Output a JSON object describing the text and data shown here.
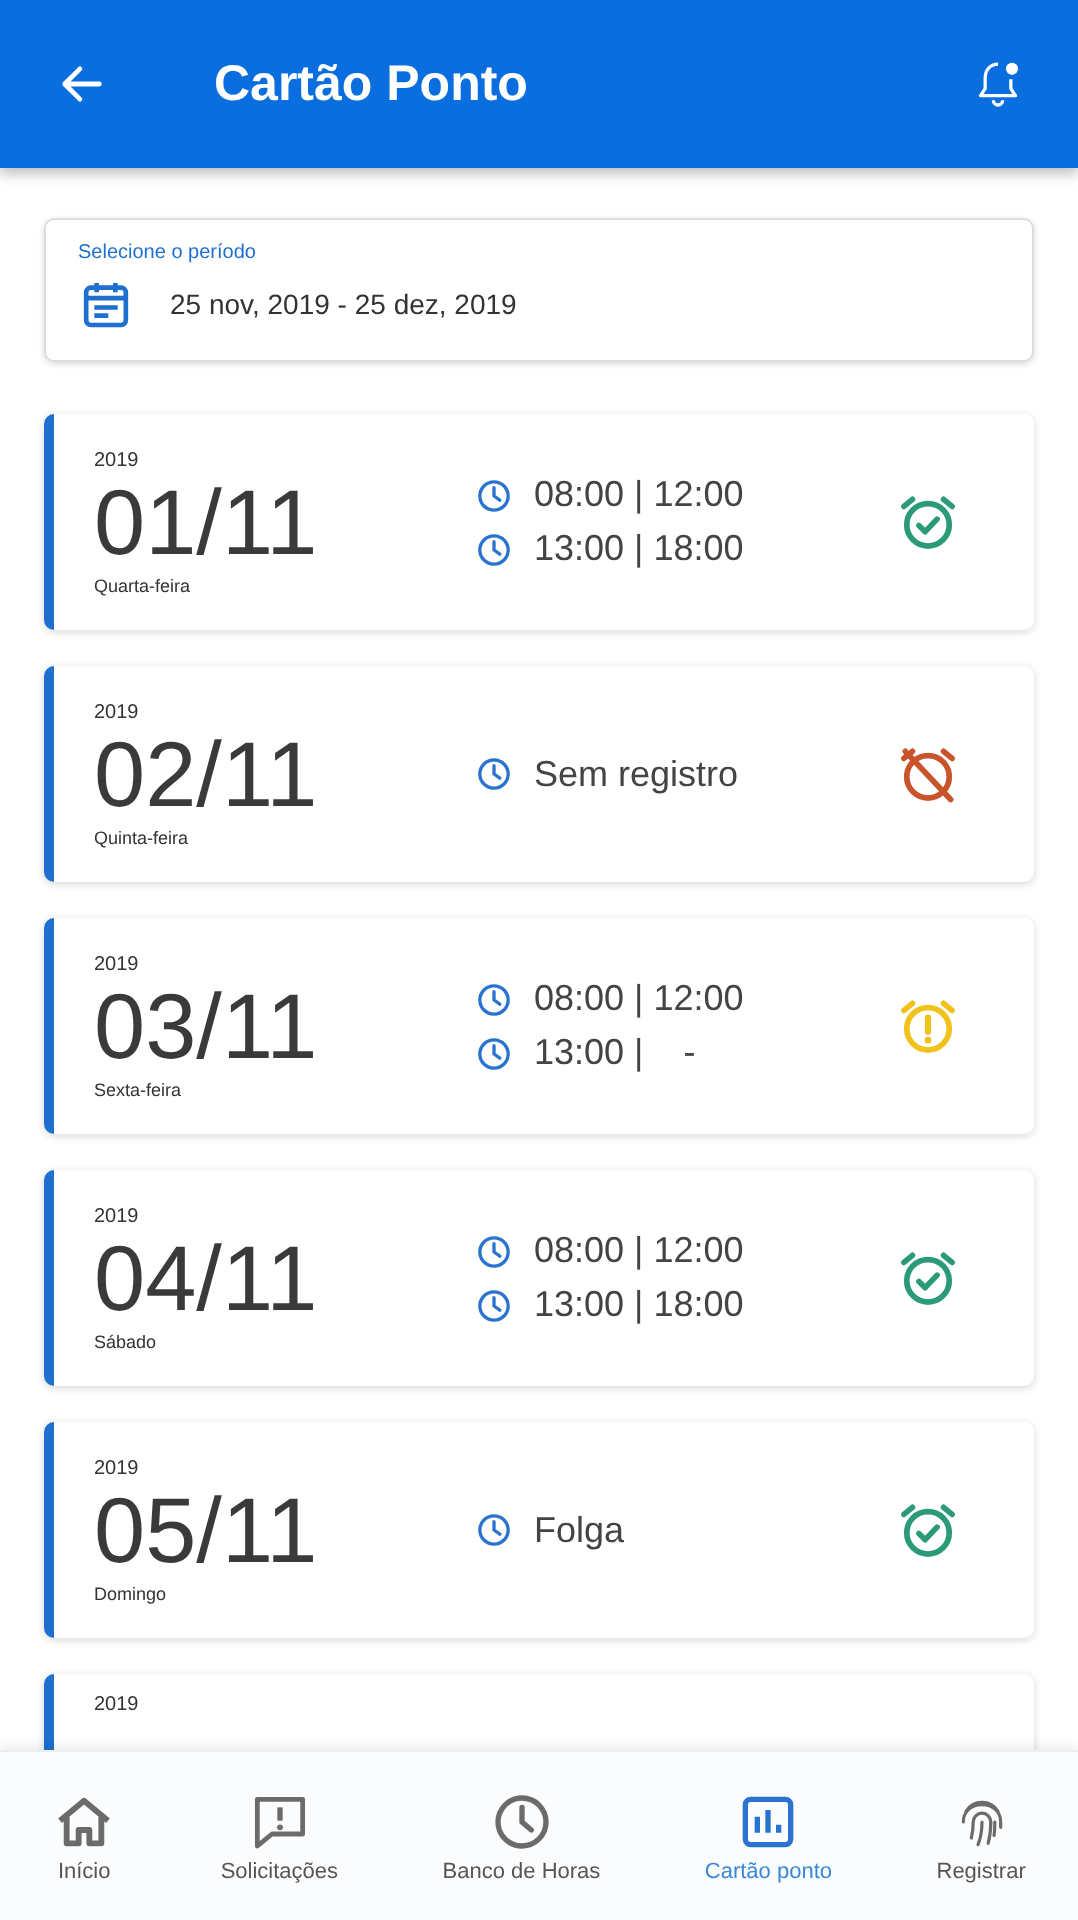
{
  "header": {
    "title": "Cartão Ponto"
  },
  "period": {
    "label": "Selecione o período",
    "value": "25 nov, 2019 - 25 dez, 2019"
  },
  "days": [
    {
      "year": "2019",
      "date": "01/11",
      "weekday": "Quarta-feira",
      "lines": [
        "08:00 | 12:00",
        "13:00 | 18:00"
      ],
      "kind": "ok"
    },
    {
      "year": "2019",
      "date": "02/11",
      "weekday": "Quinta-feira",
      "lines": [
        "Sem registro"
      ],
      "kind": "missing"
    },
    {
      "year": "2019",
      "date": "03/11",
      "weekday": "Sexta-feira",
      "lines": [
        "08:00 | 12:00",
        "13:00 |    -"
      ],
      "kind": "warning"
    },
    {
      "year": "2019",
      "date": "04/11",
      "weekday": "Sábado",
      "lines": [
        "08:00 | 12:00",
        "13:00 | 18:00"
      ],
      "kind": "ok"
    },
    {
      "year": "2019",
      "date": "05/11",
      "weekday": "Domingo",
      "lines": [
        "Folga"
      ],
      "kind": "ok"
    },
    {
      "year": "2019"
    }
  ],
  "nav": [
    {
      "label": "Início",
      "selected": false
    },
    {
      "label": "Solicitações",
      "selected": false
    },
    {
      "label": "Banco de Horas",
      "selected": false
    },
    {
      "label": "Cartão ponto",
      "selected": true
    },
    {
      "label": "Registrar",
      "selected": false
    }
  ]
}
